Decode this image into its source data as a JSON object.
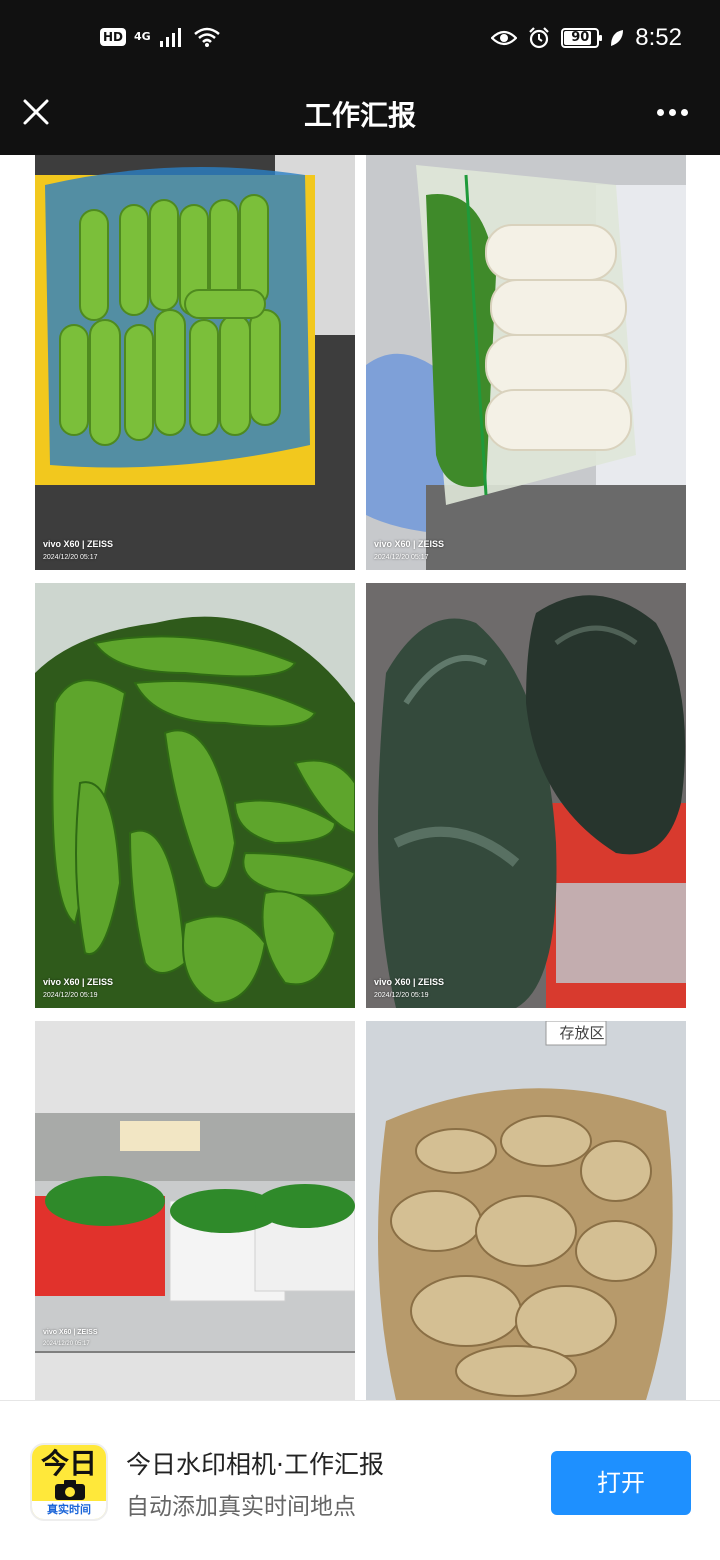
{
  "status_bar": {
    "hd_label": "HD",
    "network_label": "4G",
    "battery_level": "90",
    "battery_fraction": 0.9,
    "time": "8:52",
    "icons": [
      "signal-icon",
      "wifi-icon",
      "eye-icon",
      "alarm-icon",
      "battery-icon",
      "leaf-icon"
    ]
  },
  "header": {
    "title": "工作汇报",
    "close_icon": "close-icon",
    "more_icon": "more-icon"
  },
  "photos": [
    {
      "subject": "cucumbers",
      "watermark": "vivo X60 | ZEISS",
      "timestamp": "2024/12/20 05:17"
    },
    {
      "subject": "white-radishes",
      "watermark": "vivo X60 | ZEISS",
      "timestamp": "2024/12/20 05:17"
    },
    {
      "subject": "green-peppers",
      "watermark": "vivo X60 | ZEISS",
      "timestamp": "2024/12/20 05:19"
    },
    {
      "subject": "winter-melons",
      "watermark": "vivo X60 | ZEISS",
      "timestamp": "2024/12/20 05:19"
    },
    {
      "subject": "leafy-greens",
      "watermark": "vivo X60 | ZEISS",
      "timestamp": "2024/12/20 05:17"
    },
    {
      "subject": "ginger",
      "sign_text": "存放区"
    }
  ],
  "promo": {
    "app_icon_top": "今日",
    "app_icon_bottom": "真实时间",
    "title": "今日水印相机·工作汇报",
    "subtitle": "自动添加真实时间地点",
    "open_label": "打开"
  },
  "colors": {
    "bar_background": "#111111",
    "open_button": "#1e90ff",
    "app_icon_yellow": "#ffe83a"
  }
}
